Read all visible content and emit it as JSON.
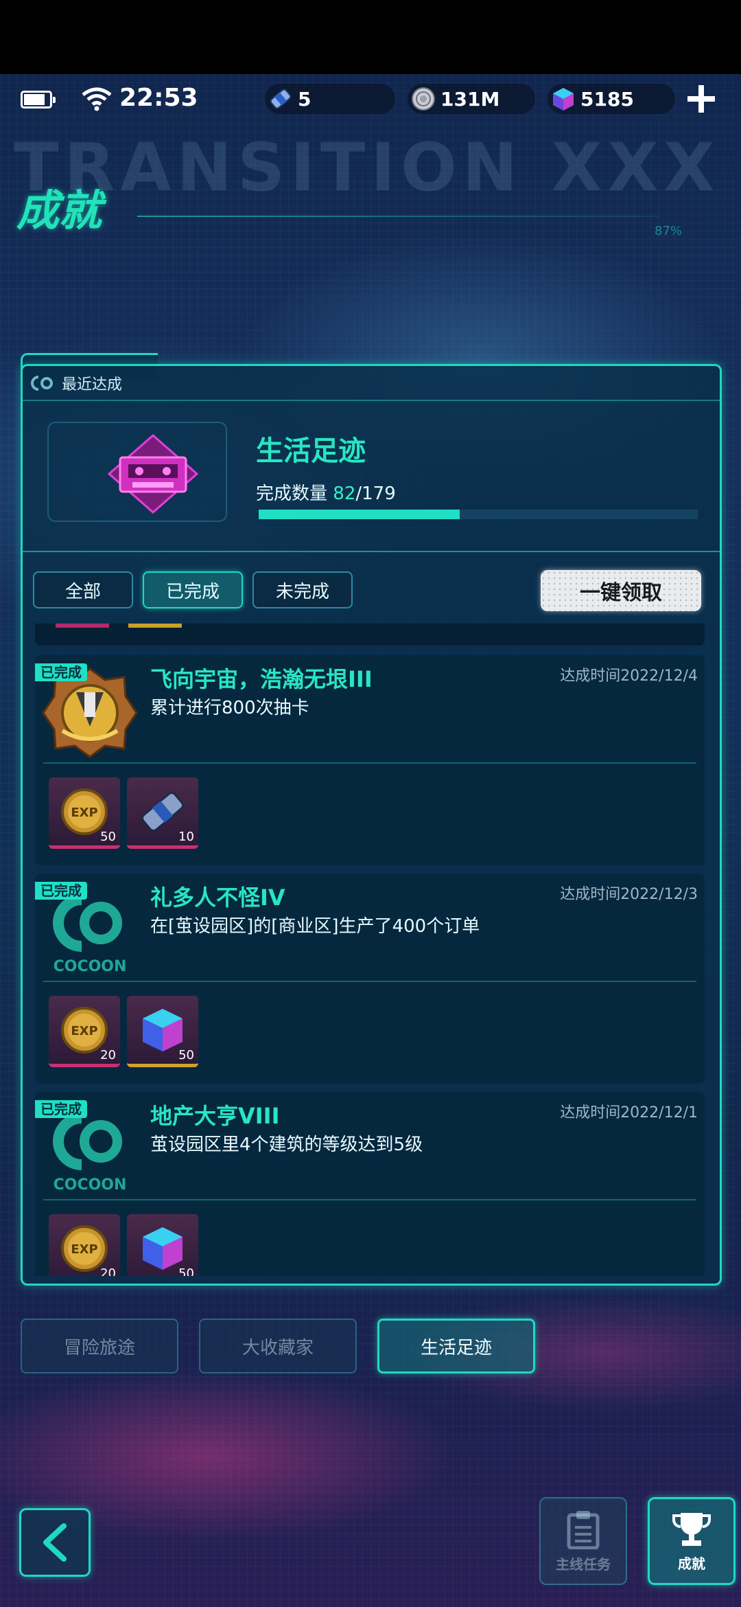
{
  "status_bar": {
    "time": "22:53",
    "tickets": "5",
    "coins": "131M",
    "gems": "5185"
  },
  "header": {
    "title": "成就",
    "ghost_text": "TRANSITION XXX",
    "percent": "87%"
  },
  "recent": {
    "label": "最近达成",
    "category_title": "生活足迹",
    "progress_label": "完成数量",
    "progress_current": "82",
    "progress_total": "/179",
    "progress_fraction": 0.458
  },
  "filters": {
    "all": "全部",
    "completed": "已完成",
    "incomplete": "未完成",
    "active": "completed"
  },
  "claim_all_label": "一键领取",
  "achievements": [
    {
      "badge": "已完成",
      "name": "飞向宇宙，浩瀚无垠III",
      "desc": "累计进行800次抽卡",
      "time": "达成时间2022/12/4",
      "icon": "gold-badge-icon",
      "rewards": [
        {
          "icon": "exp-coin-icon",
          "qty": "50",
          "rim": "pink"
        },
        {
          "icon": "ticket-icon",
          "qty": "10",
          "rim": "pink"
        }
      ]
    },
    {
      "badge": "已完成",
      "name": "礼多人不怪IV",
      "desc": "在[茧设园区]的[商业区]生产了400个订单",
      "time": "达成时间2022/12/3",
      "icon": "cocoon-logo-icon",
      "rewards": [
        {
          "icon": "exp-coin-icon",
          "qty": "20",
          "rim": "pink"
        },
        {
          "icon": "cube-icon",
          "qty": "50",
          "rim": "gold"
        }
      ]
    },
    {
      "badge": "已完成",
      "name": "地产大亨VIII",
      "desc": "茧设园区里4个建筑的等级达到5级",
      "time": "达成时间2022/12/1",
      "icon": "cocoon-logo-icon",
      "rewards": [
        {
          "icon": "exp-coin-icon",
          "qty": "20",
          "rim": "pink"
        },
        {
          "icon": "cube-icon",
          "qty": "50",
          "rim": "gold"
        }
      ]
    }
  ],
  "icon_text": {
    "exp": "EXP",
    "cocoon": "COCOON"
  },
  "bottom_tabs": [
    "冒险旅途",
    "大收藏家",
    "生活足迹"
  ],
  "bottom_tab_active": "生活足迹",
  "nav": {
    "quests": "主线任务",
    "achievements": "成就"
  },
  "colors": {
    "accent": "#20d9c0",
    "title": "#28e6c2",
    "claim_bg": "#e9ecef",
    "rim_pink": "#c8306f",
    "rim_gold": "#d0a32c"
  }
}
